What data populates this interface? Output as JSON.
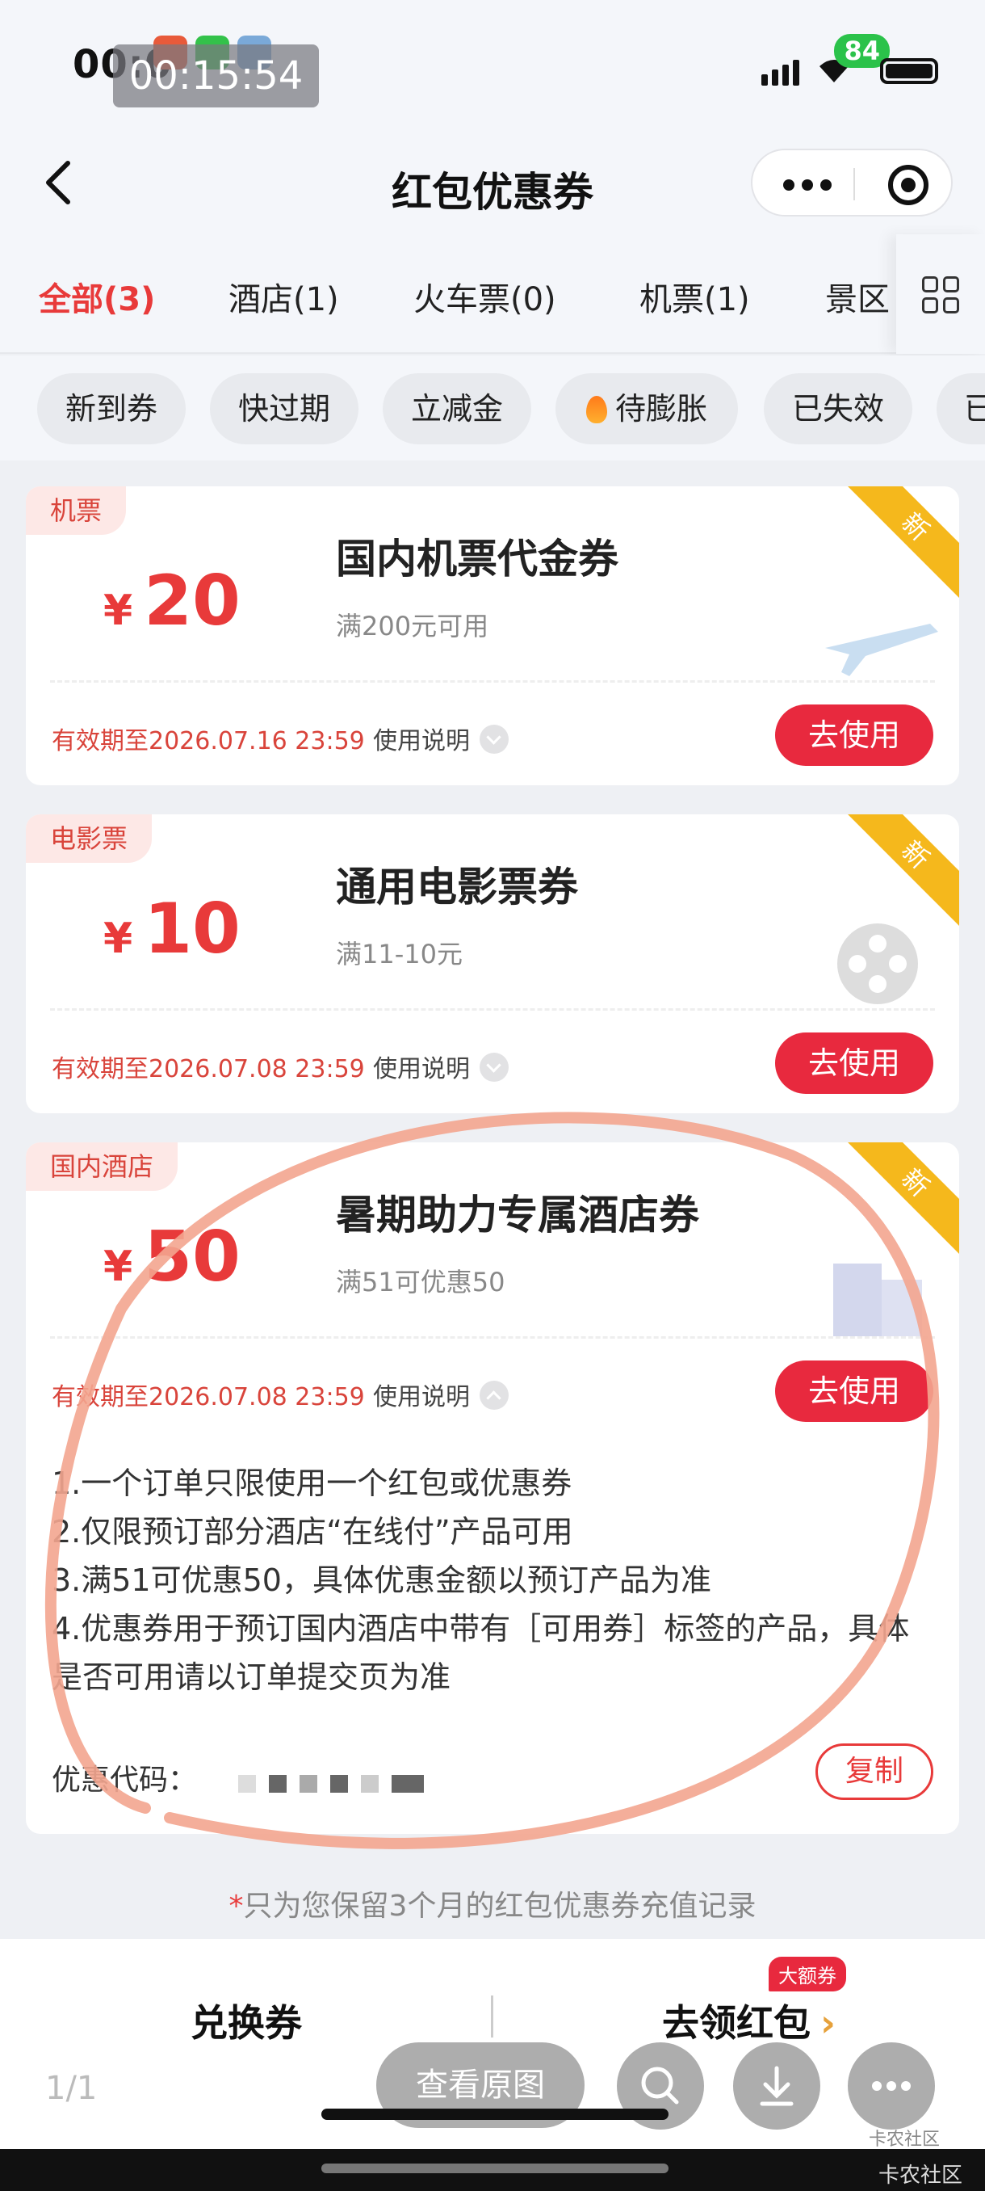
{
  "status": {
    "time": "00:0",
    "timer": "00:15:54",
    "battery": "84"
  },
  "title": "红包优惠券",
  "category_tabs": [
    "全部(3)",
    "酒店(1)",
    "火车票(0)",
    "机票(1)",
    "景区"
  ],
  "filters": [
    "新到券",
    "快过期",
    "立减金",
    "待膨胀",
    "已失效",
    "已"
  ],
  "coupons": [
    {
      "tag": "机票",
      "currency": "¥",
      "amount": "20",
      "name": "国内机票代金券",
      "condition": "满200元可用",
      "validity": "有效期至2026.07.16 23:59",
      "desc_label": "使用说明",
      "use_label": "去使用",
      "ribbon": "新"
    },
    {
      "tag": "电影票",
      "currency": "¥",
      "amount": "10",
      "name": "通用电影票券",
      "condition": "满11-10元",
      "validity": "有效期至2026.07.08 23:59",
      "desc_label": "使用说明",
      "use_label": "去使用",
      "ribbon": "新"
    },
    {
      "tag": "国内酒店",
      "currency": "¥",
      "amount": "50",
      "name": "暑期助力专属酒店券",
      "condition": "满51可优惠50",
      "validity": "有效期至2026.07.08 23:59",
      "desc_label": "使用说明",
      "use_label": "去使用",
      "ribbon": "新",
      "rules": [
        "1.一个订单只限使用一个红包或优惠券",
        "2.仅限预订部分酒店“在线付”产品可用",
        "3.满51可优惠50，具体优惠金额以预订产品为准",
        "4.优惠券用于预订国内酒店中带有［可用券］标签的产品，具体是否可用请以订单提交页为准"
      ],
      "code_label": "优惠代码：",
      "copy_label": "复制"
    }
  ],
  "retention_note": "只为您保留3个月的红包优惠券充值记录",
  "retention_star": "*",
  "bottom": {
    "exchange": "兑换券",
    "get_redpacket": "去领红包",
    "arrow": "›",
    "badge": "大额券"
  },
  "viewer": {
    "page": "1/1",
    "view_original": "查看原图"
  },
  "footer": {
    "brand": "卡农社区",
    "brand_small": "卡农社区"
  },
  "colors": {
    "accent": "#e83a3a",
    "button": "#e8293e",
    "ribbon": "#f5b81c",
    "annotation": "#f3a58f"
  }
}
